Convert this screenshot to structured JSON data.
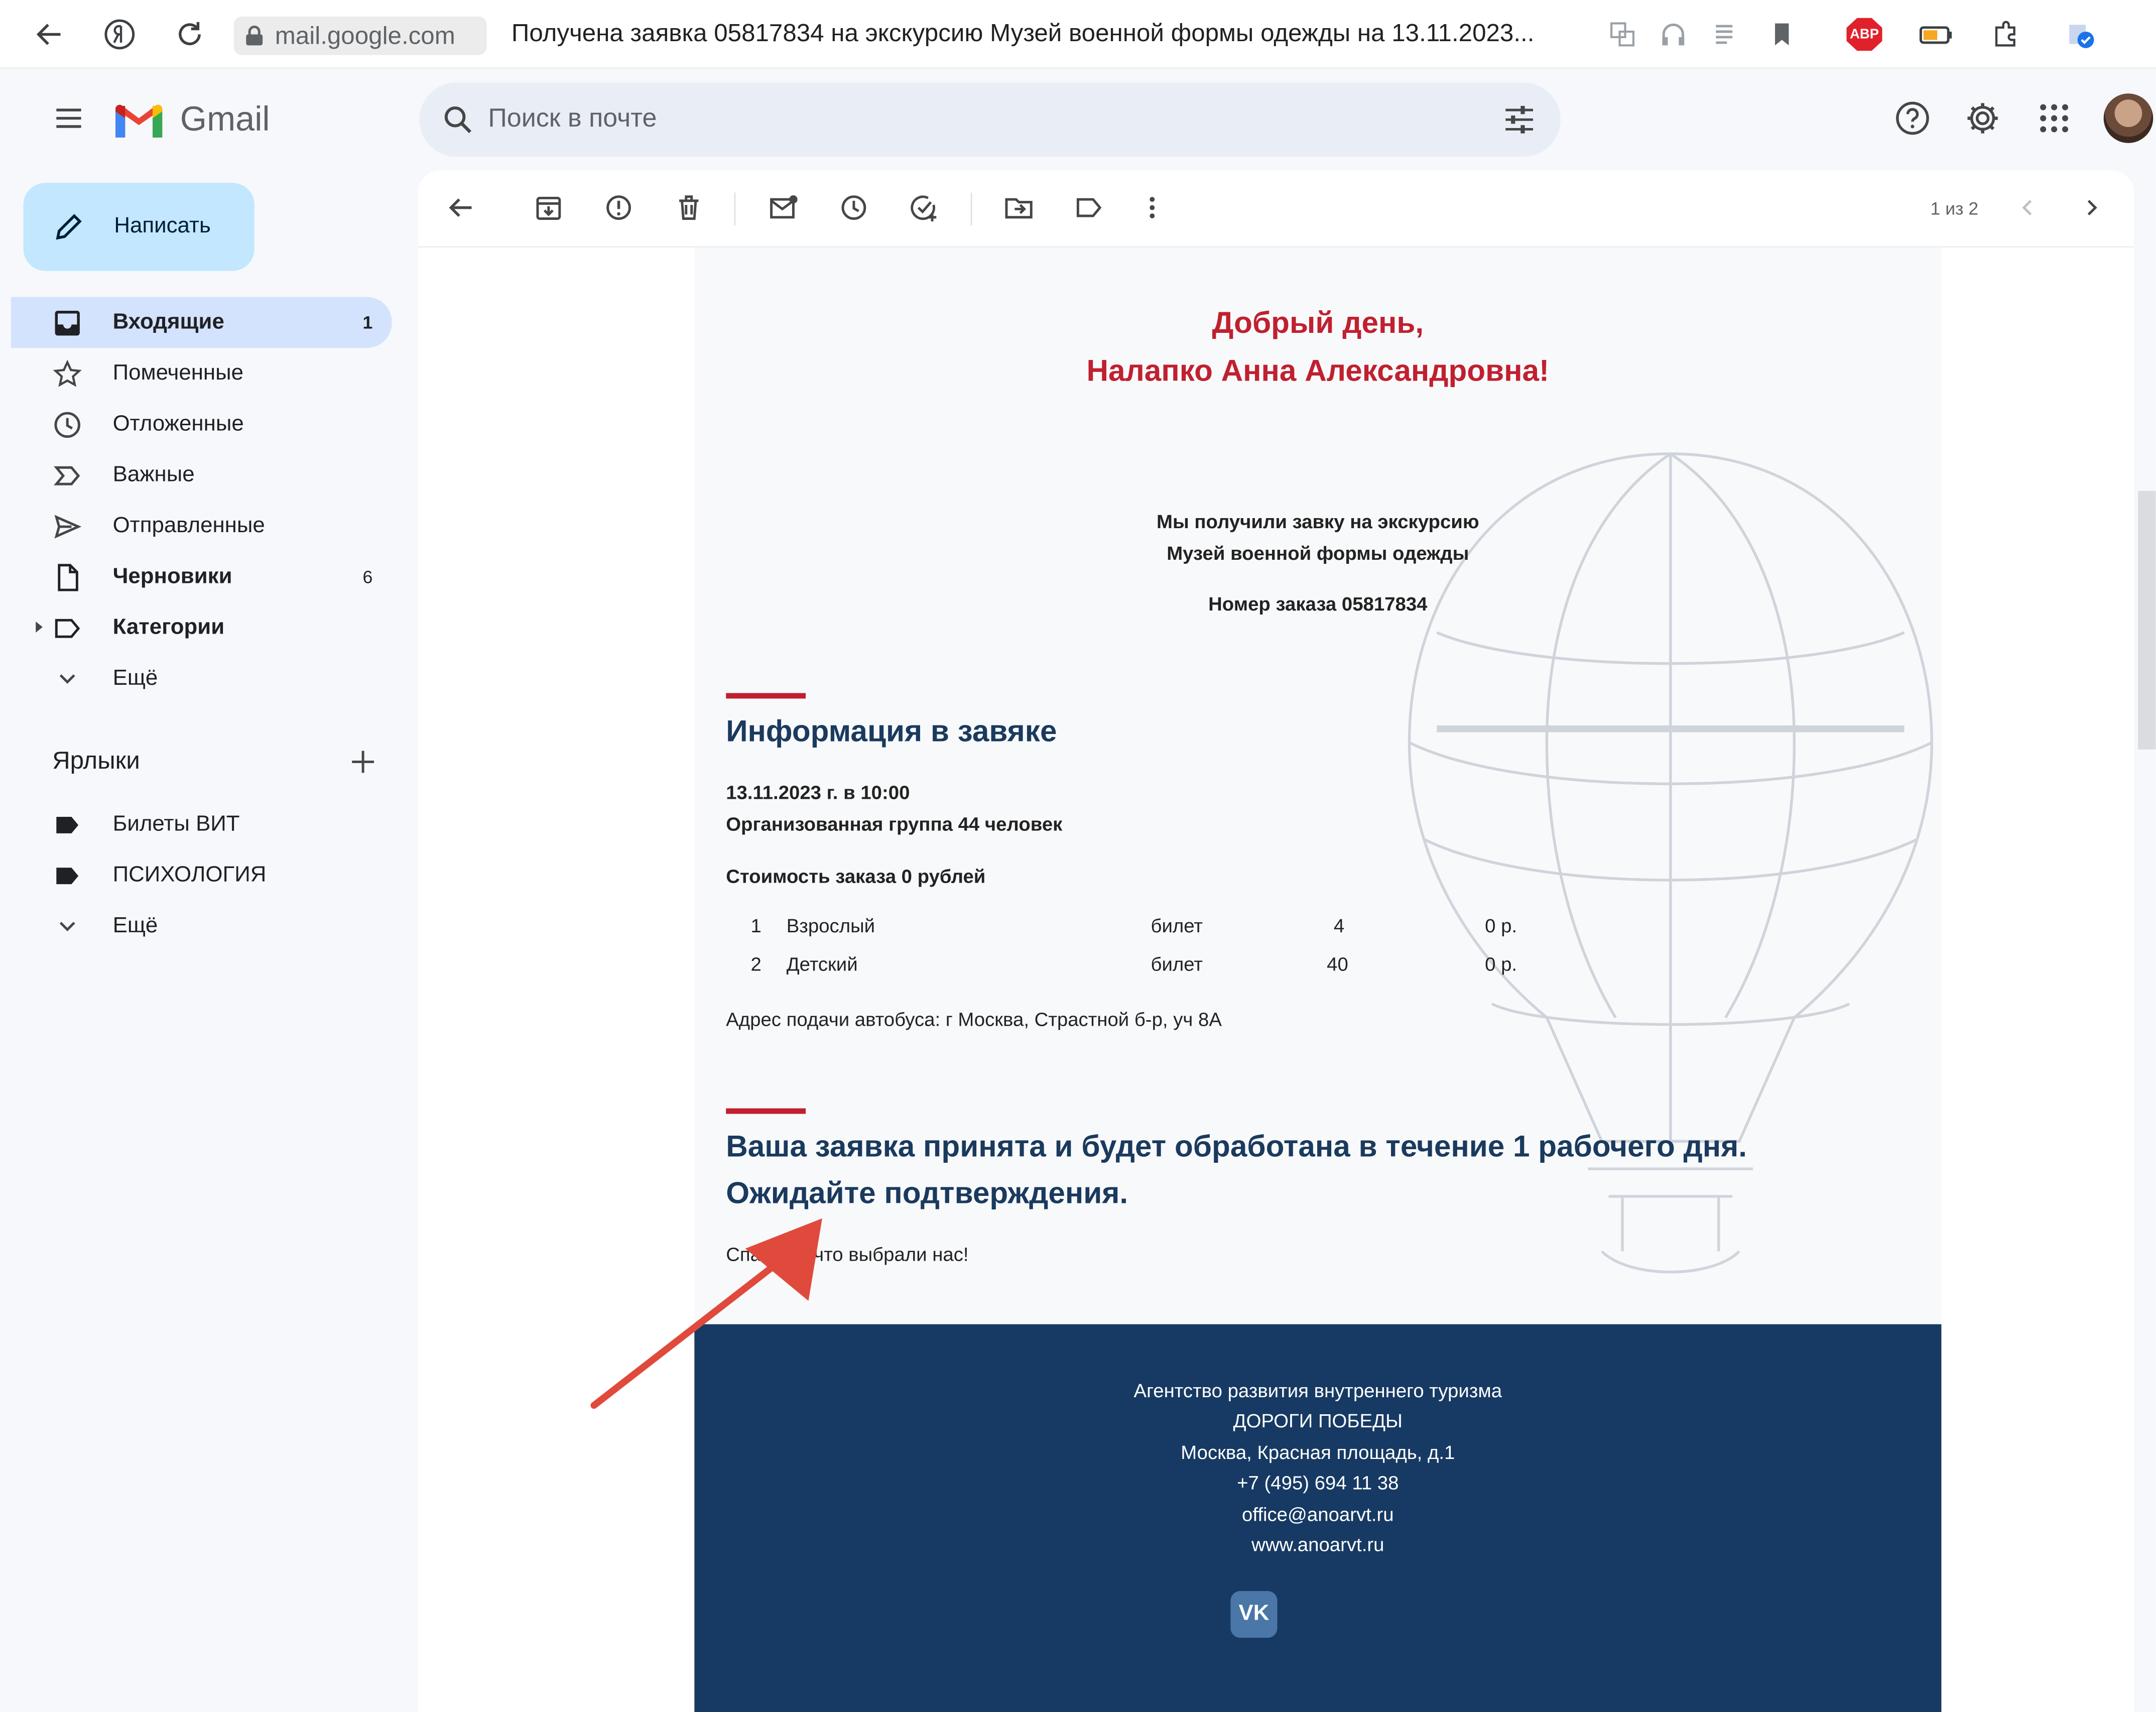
{
  "browser": {
    "url": "mail.google.com",
    "tab_title": "Получена заявка 05817834 на экскурсию Музей военной формы одежды на 13.11.2023...",
    "abp_label": "ABP"
  },
  "header": {
    "app_name": "Gmail",
    "search_placeholder": "Поиск в почте"
  },
  "sidebar": {
    "compose_label": "Написать",
    "items": [
      {
        "label": "Входящие",
        "count": "1",
        "icon": "inbox-icon",
        "active": true,
        "bold": true
      },
      {
        "label": "Помеченные",
        "count": "",
        "icon": "star-icon"
      },
      {
        "label": "Отложенные",
        "count": "",
        "icon": "clock-icon"
      },
      {
        "label": "Важные",
        "count": "",
        "icon": "important-icon"
      },
      {
        "label": "Отправленные",
        "count": "",
        "icon": "send-icon"
      },
      {
        "label": "Черновики",
        "count": "6",
        "icon": "draft-icon",
        "bold": true
      },
      {
        "label": "Категории",
        "count": "",
        "icon": "label-outline-icon",
        "bold": true
      },
      {
        "label": "Ещё",
        "count": "",
        "icon": "chevron-down-icon"
      }
    ],
    "labels_heading": "Ярлыки",
    "labels": [
      {
        "label": "Билеты ВИТ",
        "icon": "label-icon"
      },
      {
        "label": "ПСИХОЛОГИЯ",
        "icon": "label-icon"
      },
      {
        "label": "Ещё",
        "icon": "chevron-down-icon"
      }
    ]
  },
  "toolbar": {
    "pager": "1 из 2"
  },
  "email": {
    "greeting_1": "Добрый день,",
    "greeting_2": "Налапко Анна Александровна!",
    "intro_1": "Мы получили завку на экскурсию",
    "intro_2": "Музей военной формы одежды",
    "order_number": "Номер заказа 05817834",
    "info_title": "Информация в завяке",
    "date_line": "13.11.2023 г. в 10:00",
    "group_line": "Организованная группа 44 человек",
    "cost_line": "Стоимость заказа 0 рублей",
    "tickets": [
      {
        "n": "1",
        "type": "Взрослый",
        "kind": "билет",
        "qty": "4",
        "price": "0 р."
      },
      {
        "n": "2",
        "type": "Детский",
        "kind": "билет",
        "qty": "40",
        "price": "0 р."
      }
    ],
    "bus_address": "Адрес подачи автобуса: г Москва, Страстной б-р, уч 8А",
    "status_1": "Ваша заявка принята и будет обработана в течение 1 рабочего дня.",
    "status_2": "Ожидайте подтверждения.",
    "thanks": "Спасибо, что выбрали нас!",
    "footer": {
      "line_1": "Агентство развития внутреннего туризма",
      "line_2": "ДОРОГИ ПОБЕДЫ",
      "line_3": "Москва, Красная площадь, д.1",
      "phone": "+7 (495) 694 11 38",
      "email": "office@anoarvt.ru",
      "site": "www.anoarvt.ru",
      "vk_label": "VK"
    }
  },
  "colors": {
    "accent_red": "#c0202f",
    "navy": "#163a63",
    "compose_bg": "#c2e7ff",
    "active_nav": "#d3e3fd"
  }
}
